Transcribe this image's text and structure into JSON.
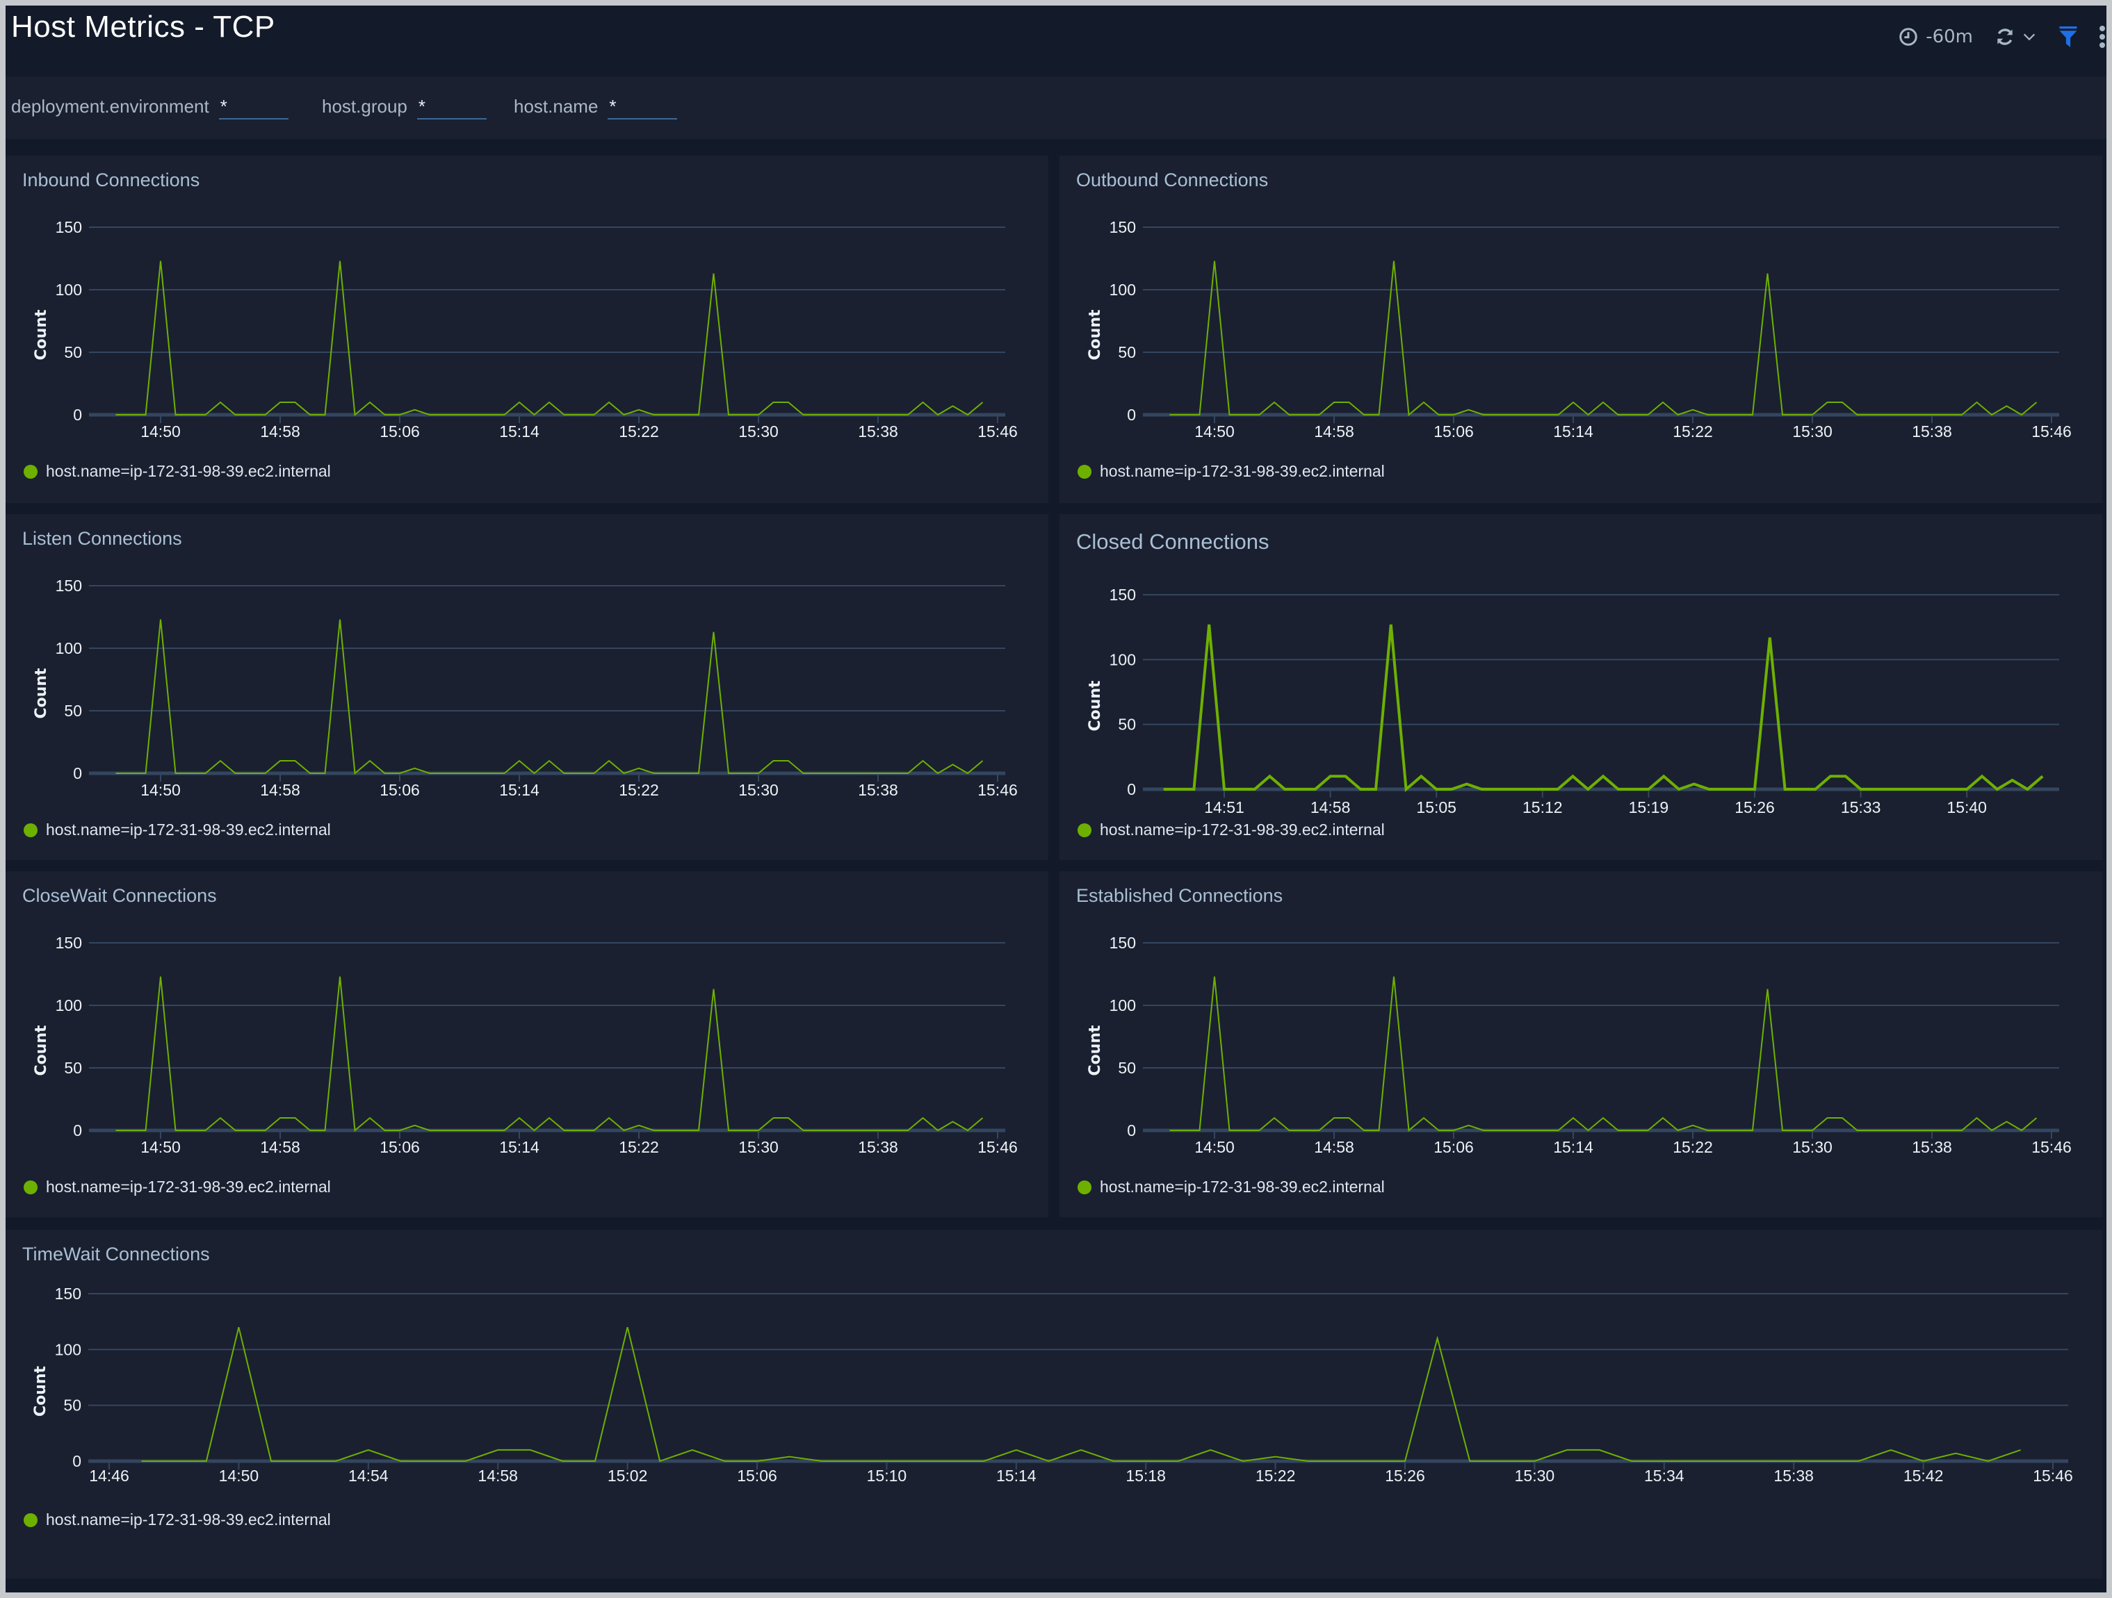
{
  "header": {
    "title": "Host Metrics - TCP",
    "time_range": "-60m",
    "icons": [
      "clock-icon",
      "refresh-icon",
      "chevron-down-icon",
      "filter-icon",
      "more-vertical-icon"
    ],
    "accent_color": "#1f6fe5"
  },
  "filters": [
    {
      "label": "deployment.environment",
      "value": "*"
    },
    {
      "label": "host.group",
      "value": "*"
    },
    {
      "label": "host.name",
      "value": "*"
    }
  ],
  "series_color": "#6eb000",
  "chart_data": [
    {
      "id": "inbound",
      "type": "line",
      "title": "Inbound Connections",
      "xlabel": "",
      "ylabel": "Count",
      "ylim": [
        0,
        150
      ],
      "yticks": [
        0,
        50,
        100,
        150
      ],
      "xticks": [
        "14:50",
        "14:58",
        "15:06",
        "15:14",
        "15:22",
        "15:30",
        "15:38",
        "15:46"
      ],
      "grid": true,
      "legend": "bottom-left",
      "x": [
        "14:47",
        "14:48",
        "14:49",
        "14:50",
        "14:51",
        "14:52",
        "14:53",
        "14:54",
        "14:55",
        "14:56",
        "14:57",
        "14:58",
        "14:59",
        "15:00",
        "15:01",
        "15:02",
        "15:03",
        "15:04",
        "15:05",
        "15:06",
        "15:07",
        "15:08",
        "15:09",
        "15:10",
        "15:11",
        "15:12",
        "15:13",
        "15:14",
        "15:15",
        "15:16",
        "15:17",
        "15:18",
        "15:19",
        "15:20",
        "15:21",
        "15:22",
        "15:23",
        "15:24",
        "15:25",
        "15:26",
        "15:27",
        "15:28",
        "15:29",
        "15:30",
        "15:31",
        "15:32",
        "15:33",
        "15:34",
        "15:35",
        "15:36",
        "15:37",
        "15:38",
        "15:39",
        "15:40",
        "15:41",
        "15:42",
        "15:43",
        "15:44",
        "15:45"
      ],
      "series": [
        {
          "name": "host.name=ip-172-31-98-39.ec2.internal",
          "values": [
            0,
            0,
            0,
            123,
            0,
            0,
            0,
            10,
            0,
            0,
            0,
            10,
            10,
            0,
            0,
            123,
            0,
            10,
            0,
            0,
            4,
            0,
            0,
            0,
            0,
            0,
            0,
            10,
            0,
            10,
            0,
            0,
            0,
            10,
            0,
            4,
            0,
            0,
            0,
            0,
            113,
            0,
            0,
            0,
            10,
            10,
            0,
            0,
            0,
            0,
            0,
            0,
            0,
            0,
            10,
            0,
            7,
            0,
            10
          ]
        }
      ]
    },
    {
      "id": "outbound",
      "type": "line",
      "title": "Outbound Connections",
      "xlabel": "",
      "ylabel": "Count",
      "ylim": [
        0,
        150
      ],
      "yticks": [
        0,
        50,
        100,
        150
      ],
      "xticks": [
        "14:50",
        "14:58",
        "15:06",
        "15:14",
        "15:22",
        "15:30",
        "15:38",
        "15:46"
      ],
      "grid": true,
      "legend": "bottom-left",
      "x": [
        "14:47",
        "14:48",
        "14:49",
        "14:50",
        "14:51",
        "14:52",
        "14:53",
        "14:54",
        "14:55",
        "14:56",
        "14:57",
        "14:58",
        "14:59",
        "15:00",
        "15:01",
        "15:02",
        "15:03",
        "15:04",
        "15:05",
        "15:06",
        "15:07",
        "15:08",
        "15:09",
        "15:10",
        "15:11",
        "15:12",
        "15:13",
        "15:14",
        "15:15",
        "15:16",
        "15:17",
        "15:18",
        "15:19",
        "15:20",
        "15:21",
        "15:22",
        "15:23",
        "15:24",
        "15:25",
        "15:26",
        "15:27",
        "15:28",
        "15:29",
        "15:30",
        "15:31",
        "15:32",
        "15:33",
        "15:34",
        "15:35",
        "15:36",
        "15:37",
        "15:38",
        "15:39",
        "15:40",
        "15:41",
        "15:42",
        "15:43",
        "15:44",
        "15:45"
      ],
      "series": [
        {
          "name": "host.name=ip-172-31-98-39.ec2.internal",
          "values": [
            0,
            0,
            0,
            123,
            0,
            0,
            0,
            10,
            0,
            0,
            0,
            10,
            10,
            0,
            0,
            123,
            0,
            10,
            0,
            0,
            4,
            0,
            0,
            0,
            0,
            0,
            0,
            10,
            0,
            10,
            0,
            0,
            0,
            10,
            0,
            4,
            0,
            0,
            0,
            0,
            113,
            0,
            0,
            0,
            10,
            10,
            0,
            0,
            0,
            0,
            0,
            0,
            0,
            0,
            10,
            0,
            7,
            0,
            10
          ]
        }
      ]
    },
    {
      "id": "listen",
      "type": "line",
      "title": "Listen Connections",
      "xlabel": "",
      "ylabel": "Count",
      "ylim": [
        0,
        150
      ],
      "yticks": [
        0,
        50,
        100,
        150
      ],
      "xticks": [
        "14:50",
        "14:58",
        "15:06",
        "15:14",
        "15:22",
        "15:30",
        "15:38",
        "15:46"
      ],
      "grid": true,
      "legend": "bottom-left",
      "x": [
        "14:47",
        "14:48",
        "14:49",
        "14:50",
        "14:51",
        "14:52",
        "14:53",
        "14:54",
        "14:55",
        "14:56",
        "14:57",
        "14:58",
        "14:59",
        "15:00",
        "15:01",
        "15:02",
        "15:03",
        "15:04",
        "15:05",
        "15:06",
        "15:07",
        "15:08",
        "15:09",
        "15:10",
        "15:11",
        "15:12",
        "15:13",
        "15:14",
        "15:15",
        "15:16",
        "15:17",
        "15:18",
        "15:19",
        "15:20",
        "15:21",
        "15:22",
        "15:23",
        "15:24",
        "15:25",
        "15:26",
        "15:27",
        "15:28",
        "15:29",
        "15:30",
        "15:31",
        "15:32",
        "15:33",
        "15:34",
        "15:35",
        "15:36",
        "15:37",
        "15:38",
        "15:39",
        "15:40",
        "15:41",
        "15:42",
        "15:43",
        "15:44",
        "15:45"
      ],
      "series": [
        {
          "name": "host.name=ip-172-31-98-39.ec2.internal",
          "values": [
            0,
            0,
            0,
            123,
            0,
            0,
            0,
            10,
            0,
            0,
            0,
            10,
            10,
            0,
            0,
            123,
            0,
            10,
            0,
            0,
            4,
            0,
            0,
            0,
            0,
            0,
            0,
            10,
            0,
            10,
            0,
            0,
            0,
            10,
            0,
            4,
            0,
            0,
            0,
            0,
            113,
            0,
            0,
            0,
            10,
            10,
            0,
            0,
            0,
            0,
            0,
            0,
            0,
            0,
            10,
            0,
            7,
            0,
            10
          ]
        }
      ]
    },
    {
      "id": "closed",
      "type": "line",
      "title": "Closed Connections",
      "xlabel": "",
      "ylabel": "Count",
      "ylim": [
        0,
        150
      ],
      "yticks": [
        0,
        50,
        100,
        150
      ],
      "xticks": [
        "14:51",
        "14:58",
        "15:05",
        "15:12",
        "15:19",
        "15:26",
        "15:33",
        "15:40"
      ],
      "grid": true,
      "legend": "bottom-left",
      "x": [
        "14:47",
        "14:48",
        "14:49",
        "14:50",
        "14:51",
        "14:52",
        "14:53",
        "14:54",
        "14:55",
        "14:56",
        "14:57",
        "14:58",
        "14:59",
        "15:00",
        "15:01",
        "15:02",
        "15:03",
        "15:04",
        "15:05",
        "15:06",
        "15:07",
        "15:08",
        "15:09",
        "15:10",
        "15:11",
        "15:12",
        "15:13",
        "15:14",
        "15:15",
        "15:16",
        "15:17",
        "15:18",
        "15:19",
        "15:20",
        "15:21",
        "15:22",
        "15:23",
        "15:24",
        "15:25",
        "15:26",
        "15:27",
        "15:28",
        "15:29",
        "15:30",
        "15:31",
        "15:32",
        "15:33",
        "15:34",
        "15:35",
        "15:36",
        "15:37",
        "15:38",
        "15:39",
        "15:40",
        "15:41",
        "15:42",
        "15:43",
        "15:44",
        "15:45"
      ],
      "series": [
        {
          "name": "host.name=ip-172-31-98-39.ec2.internal",
          "values": [
            0,
            0,
            0,
            127,
            0,
            0,
            0,
            10,
            0,
            0,
            0,
            10,
            10,
            0,
            0,
            127,
            0,
            10,
            0,
            0,
            4,
            0,
            0,
            0,
            0,
            0,
            0,
            10,
            0,
            10,
            0,
            0,
            0,
            10,
            0,
            4,
            0,
            0,
            0,
            0,
            117,
            0,
            0,
            0,
            10,
            10,
            0,
            0,
            0,
            0,
            0,
            0,
            0,
            0,
            10,
            0,
            7,
            0,
            10
          ]
        }
      ]
    },
    {
      "id": "closewait",
      "type": "line",
      "title": "CloseWait Connections",
      "xlabel": "",
      "ylabel": "Count",
      "ylim": [
        0,
        150
      ],
      "yticks": [
        0,
        50,
        100,
        150
      ],
      "xticks": [
        "14:50",
        "14:58",
        "15:06",
        "15:14",
        "15:22",
        "15:30",
        "15:38",
        "15:46"
      ],
      "grid": true,
      "legend": "bottom-left",
      "x": [
        "14:47",
        "14:48",
        "14:49",
        "14:50",
        "14:51",
        "14:52",
        "14:53",
        "14:54",
        "14:55",
        "14:56",
        "14:57",
        "14:58",
        "14:59",
        "15:00",
        "15:01",
        "15:02",
        "15:03",
        "15:04",
        "15:05",
        "15:06",
        "15:07",
        "15:08",
        "15:09",
        "15:10",
        "15:11",
        "15:12",
        "15:13",
        "15:14",
        "15:15",
        "15:16",
        "15:17",
        "15:18",
        "15:19",
        "15:20",
        "15:21",
        "15:22",
        "15:23",
        "15:24",
        "15:25",
        "15:26",
        "15:27",
        "15:28",
        "15:29",
        "15:30",
        "15:31",
        "15:32",
        "15:33",
        "15:34",
        "15:35",
        "15:36",
        "15:37",
        "15:38",
        "15:39",
        "15:40",
        "15:41",
        "15:42",
        "15:43",
        "15:44",
        "15:45"
      ],
      "series": [
        {
          "name": "host.name=ip-172-31-98-39.ec2.internal",
          "values": [
            0,
            0,
            0,
            123,
            0,
            0,
            0,
            10,
            0,
            0,
            0,
            10,
            10,
            0,
            0,
            123,
            0,
            10,
            0,
            0,
            4,
            0,
            0,
            0,
            0,
            0,
            0,
            10,
            0,
            10,
            0,
            0,
            0,
            10,
            0,
            4,
            0,
            0,
            0,
            0,
            113,
            0,
            0,
            0,
            10,
            10,
            0,
            0,
            0,
            0,
            0,
            0,
            0,
            0,
            10,
            0,
            7,
            0,
            10
          ]
        }
      ]
    },
    {
      "id": "established",
      "type": "line",
      "title": "Established Connections",
      "xlabel": "",
      "ylabel": "Count",
      "ylim": [
        0,
        150
      ],
      "yticks": [
        0,
        50,
        100,
        150
      ],
      "xticks": [
        "14:50",
        "14:58",
        "15:06",
        "15:14",
        "15:22",
        "15:30",
        "15:38",
        "15:46"
      ],
      "grid": true,
      "legend": "bottom-left",
      "x": [
        "14:47",
        "14:48",
        "14:49",
        "14:50",
        "14:51",
        "14:52",
        "14:53",
        "14:54",
        "14:55",
        "14:56",
        "14:57",
        "14:58",
        "14:59",
        "15:00",
        "15:01",
        "15:02",
        "15:03",
        "15:04",
        "15:05",
        "15:06",
        "15:07",
        "15:08",
        "15:09",
        "15:10",
        "15:11",
        "15:12",
        "15:13",
        "15:14",
        "15:15",
        "15:16",
        "15:17",
        "15:18",
        "15:19",
        "15:20",
        "15:21",
        "15:22",
        "15:23",
        "15:24",
        "15:25",
        "15:26",
        "15:27",
        "15:28",
        "15:29",
        "15:30",
        "15:31",
        "15:32",
        "15:33",
        "15:34",
        "15:35",
        "15:36",
        "15:37",
        "15:38",
        "15:39",
        "15:40",
        "15:41",
        "15:42",
        "15:43",
        "15:44",
        "15:45"
      ],
      "series": [
        {
          "name": "host.name=ip-172-31-98-39.ec2.internal",
          "values": [
            0,
            0,
            0,
            123,
            0,
            0,
            0,
            10,
            0,
            0,
            0,
            10,
            10,
            0,
            0,
            123,
            0,
            10,
            0,
            0,
            4,
            0,
            0,
            0,
            0,
            0,
            0,
            10,
            0,
            10,
            0,
            0,
            0,
            10,
            0,
            4,
            0,
            0,
            0,
            0,
            113,
            0,
            0,
            0,
            10,
            10,
            0,
            0,
            0,
            0,
            0,
            0,
            0,
            0,
            10,
            0,
            7,
            0,
            10
          ]
        }
      ]
    },
    {
      "id": "timewait",
      "type": "line",
      "title": "TimeWait Connections",
      "xlabel": "",
      "ylabel": "Count",
      "ylim": [
        0,
        150
      ],
      "yticks": [
        0,
        50,
        100,
        150
      ],
      "xticks": [
        "14:46",
        "14:50",
        "14:54",
        "14:58",
        "15:02",
        "15:06",
        "15:10",
        "15:14",
        "15:18",
        "15:22",
        "15:26",
        "15:30",
        "15:34",
        "15:38",
        "15:42",
        "15:46"
      ],
      "grid": true,
      "legend": "bottom-left",
      "x": [
        "14:47",
        "14:48",
        "14:49",
        "14:50",
        "14:51",
        "14:52",
        "14:53",
        "14:54",
        "14:55",
        "14:56",
        "14:57",
        "14:58",
        "14:59",
        "15:00",
        "15:01",
        "15:02",
        "15:03",
        "15:04",
        "15:05",
        "15:06",
        "15:07",
        "15:08",
        "15:09",
        "15:10",
        "15:11",
        "15:12",
        "15:13",
        "15:14",
        "15:15",
        "15:16",
        "15:17",
        "15:18",
        "15:19",
        "15:20",
        "15:21",
        "15:22",
        "15:23",
        "15:24",
        "15:25",
        "15:26",
        "15:27",
        "15:28",
        "15:29",
        "15:30",
        "15:31",
        "15:32",
        "15:33",
        "15:34",
        "15:35",
        "15:36",
        "15:37",
        "15:38",
        "15:39",
        "15:40",
        "15:41",
        "15:42",
        "15:43",
        "15:44",
        "15:45"
      ],
      "series": [
        {
          "name": "host.name=ip-172-31-98-39.ec2.internal",
          "values": [
            0,
            0,
            0,
            120,
            0,
            0,
            0,
            10,
            0,
            0,
            0,
            10,
            10,
            0,
            0,
            120,
            0,
            10,
            0,
            0,
            4,
            0,
            0,
            0,
            0,
            0,
            0,
            10,
            0,
            10,
            0,
            0,
            0,
            10,
            0,
            4,
            0,
            0,
            0,
            0,
            110,
            0,
            0,
            0,
            10,
            10,
            0,
            0,
            0,
            0,
            0,
            0,
            0,
            0,
            10,
            0,
            7,
            0,
            10
          ]
        }
      ]
    }
  ]
}
